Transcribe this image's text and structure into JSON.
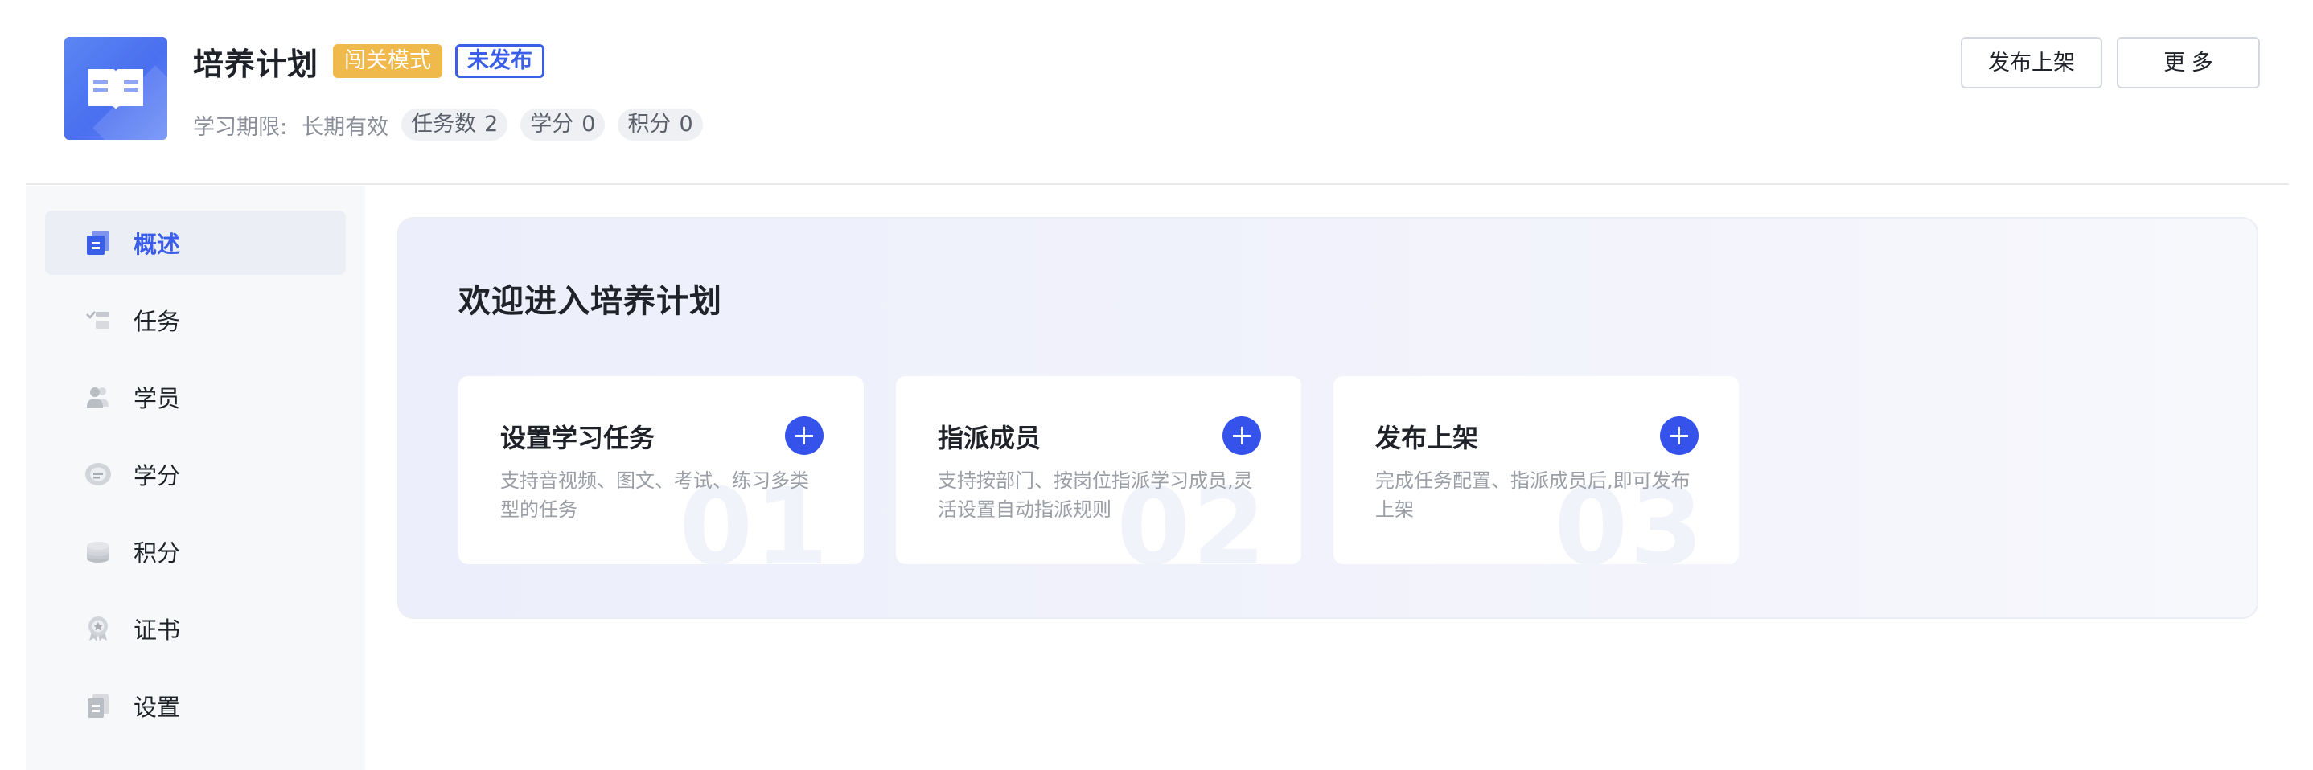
{
  "header": {
    "title": "培养计划",
    "mode_tag": "闯关模式",
    "status_tag": "未发布",
    "period_label": "学习期限:",
    "period_value": "长期有效",
    "stats": [
      {
        "label": "任务数",
        "value": "2"
      },
      {
        "label": "学分",
        "value": "0"
      },
      {
        "label": "积分",
        "value": "0"
      }
    ],
    "publish_button": "发布上架",
    "more_button": "更 多"
  },
  "sidebar": {
    "items": [
      {
        "label": "概述",
        "icon": "overview-icon",
        "active": true
      },
      {
        "label": "任务",
        "icon": "task-icon",
        "active": false
      },
      {
        "label": "学员",
        "icon": "users-icon",
        "active": false
      },
      {
        "label": "学分",
        "icon": "credit-icon",
        "active": false
      },
      {
        "label": "积分",
        "icon": "points-icon",
        "active": false
      },
      {
        "label": "证书",
        "icon": "certificate-icon",
        "active": false
      },
      {
        "label": "设置",
        "icon": "settings-icon",
        "active": false
      }
    ]
  },
  "main": {
    "welcome_title": "欢迎进入培养计划",
    "steps": [
      {
        "title": "设置学习任务",
        "desc": "支持音视频、图文、考试、练习多类型的任务",
        "number": "01"
      },
      {
        "title": "指派成员",
        "desc": "支持按部门、按岗位指派学习成员,灵活设置自动指派规则",
        "number": "02"
      },
      {
        "title": "发布上架",
        "desc": "完成任务配置、指派成员后,即可发布上架",
        "number": "03"
      }
    ]
  },
  "colors": {
    "accent": "#3a5ee8",
    "mode_tag_bg": "#f0b94b",
    "sidebar_bg": "#f7f8fa"
  }
}
